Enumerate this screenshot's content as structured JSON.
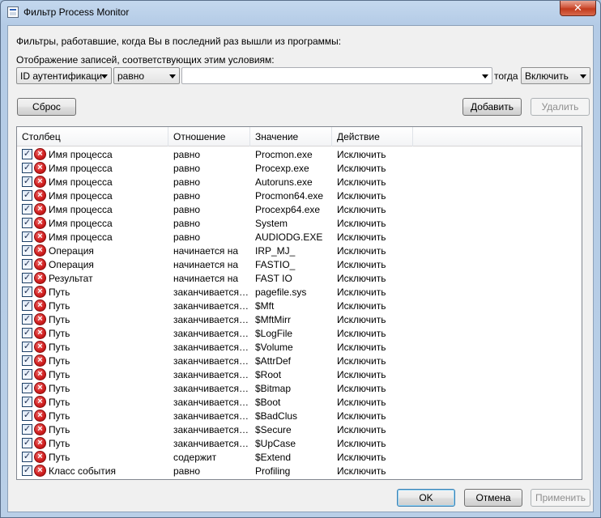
{
  "window": {
    "title": "Фильтр Process Monitor",
    "close_label": "✕"
  },
  "labels": {
    "intro": "Фильтры, работавшие, когда Вы в последний раз вышли из программы:",
    "display": "Отображение записей, соответствующих этим условиям:",
    "then": "тогда"
  },
  "filter_editor": {
    "column_value": "ID аутентификаци",
    "relation_value": "равно",
    "value_input": "",
    "action_value": "Включить"
  },
  "buttons": {
    "reset": "Сброс",
    "add": "Добавить",
    "remove": "Удалить",
    "ok": "OK",
    "cancel": "Отмена",
    "apply": "Применить"
  },
  "table": {
    "headers": [
      "Столбец",
      "Отношение",
      "Значение",
      "Действие"
    ],
    "rows": [
      {
        "column": "Имя процесса",
        "relation": "равно",
        "value": "Procmon.exe",
        "action": "Исключить",
        "checked": true
      },
      {
        "column": "Имя процесса",
        "relation": "равно",
        "value": "Procexp.exe",
        "action": "Исключить",
        "checked": true
      },
      {
        "column": "Имя процесса",
        "relation": "равно",
        "value": "Autoruns.exe",
        "action": "Исключить",
        "checked": true
      },
      {
        "column": "Имя процесса",
        "relation": "равно",
        "value": "Procmon64.exe",
        "action": "Исключить",
        "checked": true
      },
      {
        "column": "Имя процесса",
        "relation": "равно",
        "value": "Procexp64.exe",
        "action": "Исключить",
        "checked": true
      },
      {
        "column": "Имя процесса",
        "relation": "равно",
        "value": "System",
        "action": "Исключить",
        "checked": true
      },
      {
        "column": "Имя процесса",
        "relation": "равно",
        "value": "AUDIODG.EXE",
        "action": "Исключить",
        "checked": true
      },
      {
        "column": "Операция",
        "relation": "начинается на",
        "value": "IRP_MJ_",
        "action": "Исключить",
        "checked": true
      },
      {
        "column": "Операция",
        "relation": "начинается на",
        "value": "FASTIO_",
        "action": "Исключить",
        "checked": true
      },
      {
        "column": "Результат",
        "relation": "начинается на",
        "value": "FAST IO",
        "action": "Исключить",
        "checked": true
      },
      {
        "column": "Путь",
        "relation": "заканчивается ...",
        "value": "pagefile.sys",
        "action": "Исключить",
        "checked": true
      },
      {
        "column": "Путь",
        "relation": "заканчивается ...",
        "value": "$Mft",
        "action": "Исключить",
        "checked": true
      },
      {
        "column": "Путь",
        "relation": "заканчивается ...",
        "value": "$MftMirr",
        "action": "Исключить",
        "checked": true
      },
      {
        "column": "Путь",
        "relation": "заканчивается ...",
        "value": "$LogFile",
        "action": "Исключить",
        "checked": true
      },
      {
        "column": "Путь",
        "relation": "заканчивается ...",
        "value": "$Volume",
        "action": "Исключить",
        "checked": true
      },
      {
        "column": "Путь",
        "relation": "заканчивается ...",
        "value": "$AttrDef",
        "action": "Исключить",
        "checked": true
      },
      {
        "column": "Путь",
        "relation": "заканчивается ...",
        "value": "$Root",
        "action": "Исключить",
        "checked": true
      },
      {
        "column": "Путь",
        "relation": "заканчивается ...",
        "value": "$Bitmap",
        "action": "Исключить",
        "checked": true
      },
      {
        "column": "Путь",
        "relation": "заканчивается ...",
        "value": "$Boot",
        "action": "Исключить",
        "checked": true
      },
      {
        "column": "Путь",
        "relation": "заканчивается ...",
        "value": "$BadClus",
        "action": "Исключить",
        "checked": true
      },
      {
        "column": "Путь",
        "relation": "заканчивается ...",
        "value": "$Secure",
        "action": "Исключить",
        "checked": true
      },
      {
        "column": "Путь",
        "relation": "заканчивается ...",
        "value": "$UpCase",
        "action": "Исключить",
        "checked": true
      },
      {
        "column": "Путь",
        "relation": "содержит",
        "value": "$Extend",
        "action": "Исключить",
        "checked": true
      },
      {
        "column": "Класс события",
        "relation": "равно",
        "value": "Profiling",
        "action": "Исключить",
        "checked": true
      }
    ]
  },
  "icons": {
    "row_check": "checkbox-checked-icon",
    "row_action": "exclude-red-x-icon",
    "close": "close-icon",
    "app": "process-monitor-icon"
  },
  "colors": {
    "exclude_red": "#d12020",
    "titlebar": "#b9cfe7"
  }
}
